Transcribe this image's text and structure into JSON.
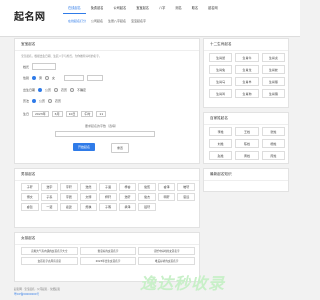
{
  "site": {
    "logo": "起名网"
  },
  "nav": [
    {
      "label": "在线起名"
    },
    {
      "label": "免费起名"
    },
    {
      "label": "公司起名"
    },
    {
      "label": "宝宝起名"
    },
    {
      "label": "八字"
    },
    {
      "label": "测名"
    },
    {
      "label": "取名"
    },
    {
      "label": "起名网"
    }
  ],
  "subnav": [
    {
      "label": "在线起名打分"
    },
    {
      "label": "公司起名"
    },
    {
      "label": "生辰八字起名"
    },
    {
      "label": "宝宝起名字"
    }
  ],
  "form": {
    "title": "宝宝起名",
    "note": "宝宝起名，根据出生日期、生辰八字与姓氏，为你推荐好听的名字。",
    "surname_label": "姓氏",
    "gender_label": "性别",
    "gender_male": "男",
    "gender_female": "女",
    "birth_label": "出生日期",
    "opt1": "公历",
    "opt2": "农历",
    "opt3": "不确定",
    "calendar_label": "历法",
    "date_label": "生日",
    "year": "2023年",
    "month": "6月",
    "day": "10日",
    "hour": "午时",
    "min": "11",
    "hint_label": "要求起名的字数（选填）",
    "submit": "开始起名",
    "reset": "重置"
  },
  "right_top": {
    "title": "十二生肖起名",
    "items": [
      "生肖鼠",
      "生肖牛",
      "生肖虎",
      "生肖兔",
      "生肖龙",
      "生肖蛇",
      "生肖马",
      "生肖羊",
      "生肖猴",
      "生肖鸡",
      "生肖狗",
      "生肖猪"
    ]
  },
  "right_mid": {
    "title": "百家姓起名",
    "items": [
      "李姓",
      "王姓",
      "张姓",
      "刘姓",
      "陈姓",
      "杨姓",
      "赵姓",
      "黄姓",
      "周姓"
    ]
  },
  "right_bottom": {
    "title": "最新起名知识"
  },
  "names_panel": {
    "title": "男孩起名",
    "items": [
      "子轩",
      "浩宇",
      "宇轩",
      "浩然",
      "子涵",
      "梓睿",
      "俊熙",
      "睿泽",
      "皓轩",
      "博文",
      "子墨",
      "宇辰",
      "文博",
      "梓轩",
      "浩轩",
      "俊杰",
      "明轩",
      "思远",
      "睿哲",
      "一诺",
      "嘉懿",
      "煜祺",
      "子骞",
      "承泽",
      "铭轩"
    ]
  },
  "tips_panel": {
    "title": "女孩起名",
    "items": [
      "高端大气有内涵的女孩名字大全",
      "寓意好的女孩名字",
      "诗经中好听的女孩名字",
      "女孩名字古风有诗意",
      "2023年出生女孩名字",
      "唯美好听的女孩名字"
    ]
  },
  "footer": {
    "text": "起名网 · 宝宝起名 · 公司起名 · 免费起名",
    "beian": "粤ICP备00000000号"
  },
  "watermark": "逸达秒收录"
}
